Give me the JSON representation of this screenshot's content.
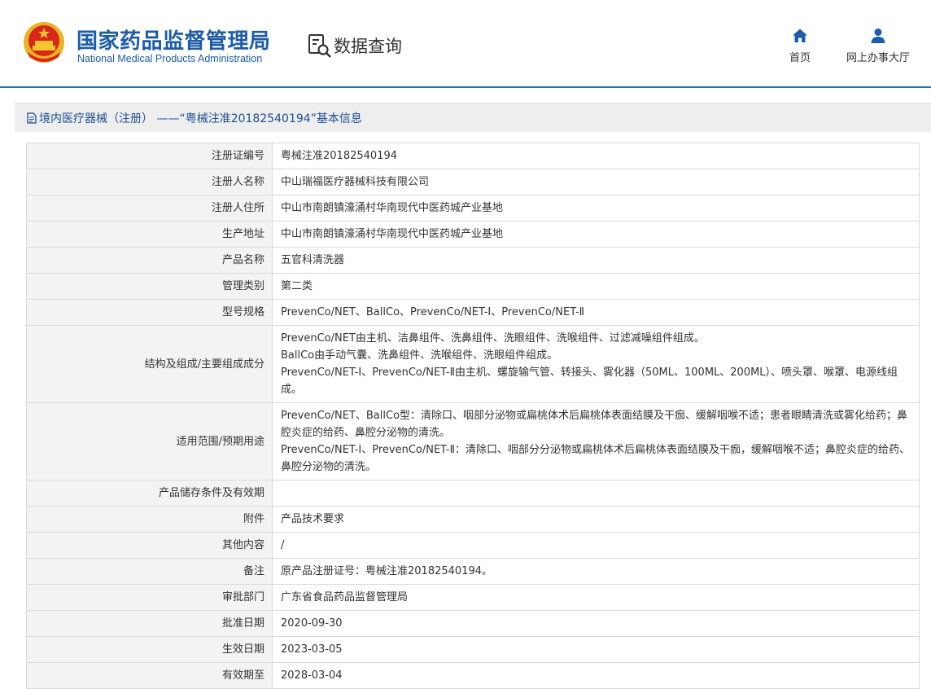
{
  "header": {
    "site_name_cn": "国家药品监督管理局",
    "site_name_en": "National Medical Products Administration",
    "data_query_label": "数据查询",
    "nav": [
      {
        "label": "首页",
        "icon": "home-icon"
      },
      {
        "label": "网上办事大厅",
        "icon": "user-icon"
      }
    ],
    "colors": {
      "brand": "#1d5ca8",
      "accent_line": "#2d6fb6"
    }
  },
  "section": {
    "title": "境内医疗器械（注册） ——“粤械注准20182540194”基本信息"
  },
  "rows": [
    {
      "key": "注册证编号",
      "value": [
        "粤械注准20182540194"
      ]
    },
    {
      "key": "注册人名称",
      "value": [
        "中山瑞福医疗器械科技有限公司"
      ]
    },
    {
      "key": "注册人住所",
      "value": [
        "中山市南朗镇濠涌村华南现代中医药城产业基地"
      ]
    },
    {
      "key": "生产地址",
      "value": [
        "中山市南朗镇濠涌村华南现代中医药城产业基地"
      ]
    },
    {
      "key": "产品名称",
      "value": [
        "五官科清洗器"
      ]
    },
    {
      "key": "管理类别",
      "value": [
        "第二类"
      ]
    },
    {
      "key": "型号规格",
      "value": [
        "PrevenCo/NET、BallCo、PrevenCo/NET-Ⅰ、PrevenCo/NET-Ⅱ"
      ]
    },
    {
      "key": "结构及组成/主要组成成分",
      "value": [
        "PrevenCo/NET由主机、洁鼻组件、洗鼻组件、洗眼组件、洗喉组件、过滤减噪组件组成。",
        "BallCo由手动气囊、洗鼻组件、洗喉组件、洗眼组件组成。",
        "PrevenCo/NET-Ⅰ、PrevenCo/NET-Ⅱ由主机、螺旋输气管、转接头、雾化器（50ML、100ML、200ML）、喷头罩、喉罩、电源线组成。"
      ]
    },
    {
      "key": "适用范围/预期用途",
      "value": [
        "PrevenCo/NET、BallCo型：清除口、咽部分泌物或扁桃体术后扁桃体表面结膜及干痂、缓解咽喉不适；患者眼睛清洗或雾化给药；鼻腔炎症的给药、鼻腔分泌物的清洗。",
        "PrevenCo/NET-Ⅰ、PrevenCo/NET-Ⅱ：清除口、咽部分分泌物或扁桃体术后扁桃体表面结膜及干痂，缓解咽喉不适；鼻腔炎症的给药、鼻腔分泌物的清洗。"
      ]
    },
    {
      "key": "产品储存条件及有效期",
      "value": [
        ""
      ]
    },
    {
      "key": "附件",
      "value": [
        "产品技术要求"
      ]
    },
    {
      "key": "其他内容",
      "value": [
        "/"
      ]
    },
    {
      "key": "备注",
      "value": [
        "原产品注册证号：粤械注准20182540194。"
      ]
    },
    {
      "key": "审批部门",
      "value": [
        "广东省食品药品监督管理局"
      ]
    },
    {
      "key": "批准日期",
      "value": [
        "2020-09-30"
      ]
    },
    {
      "key": "生效日期",
      "value": [
        "2023-03-05"
      ]
    },
    {
      "key": "有效期至",
      "value": [
        "2028-03-04"
      ]
    }
  ]
}
